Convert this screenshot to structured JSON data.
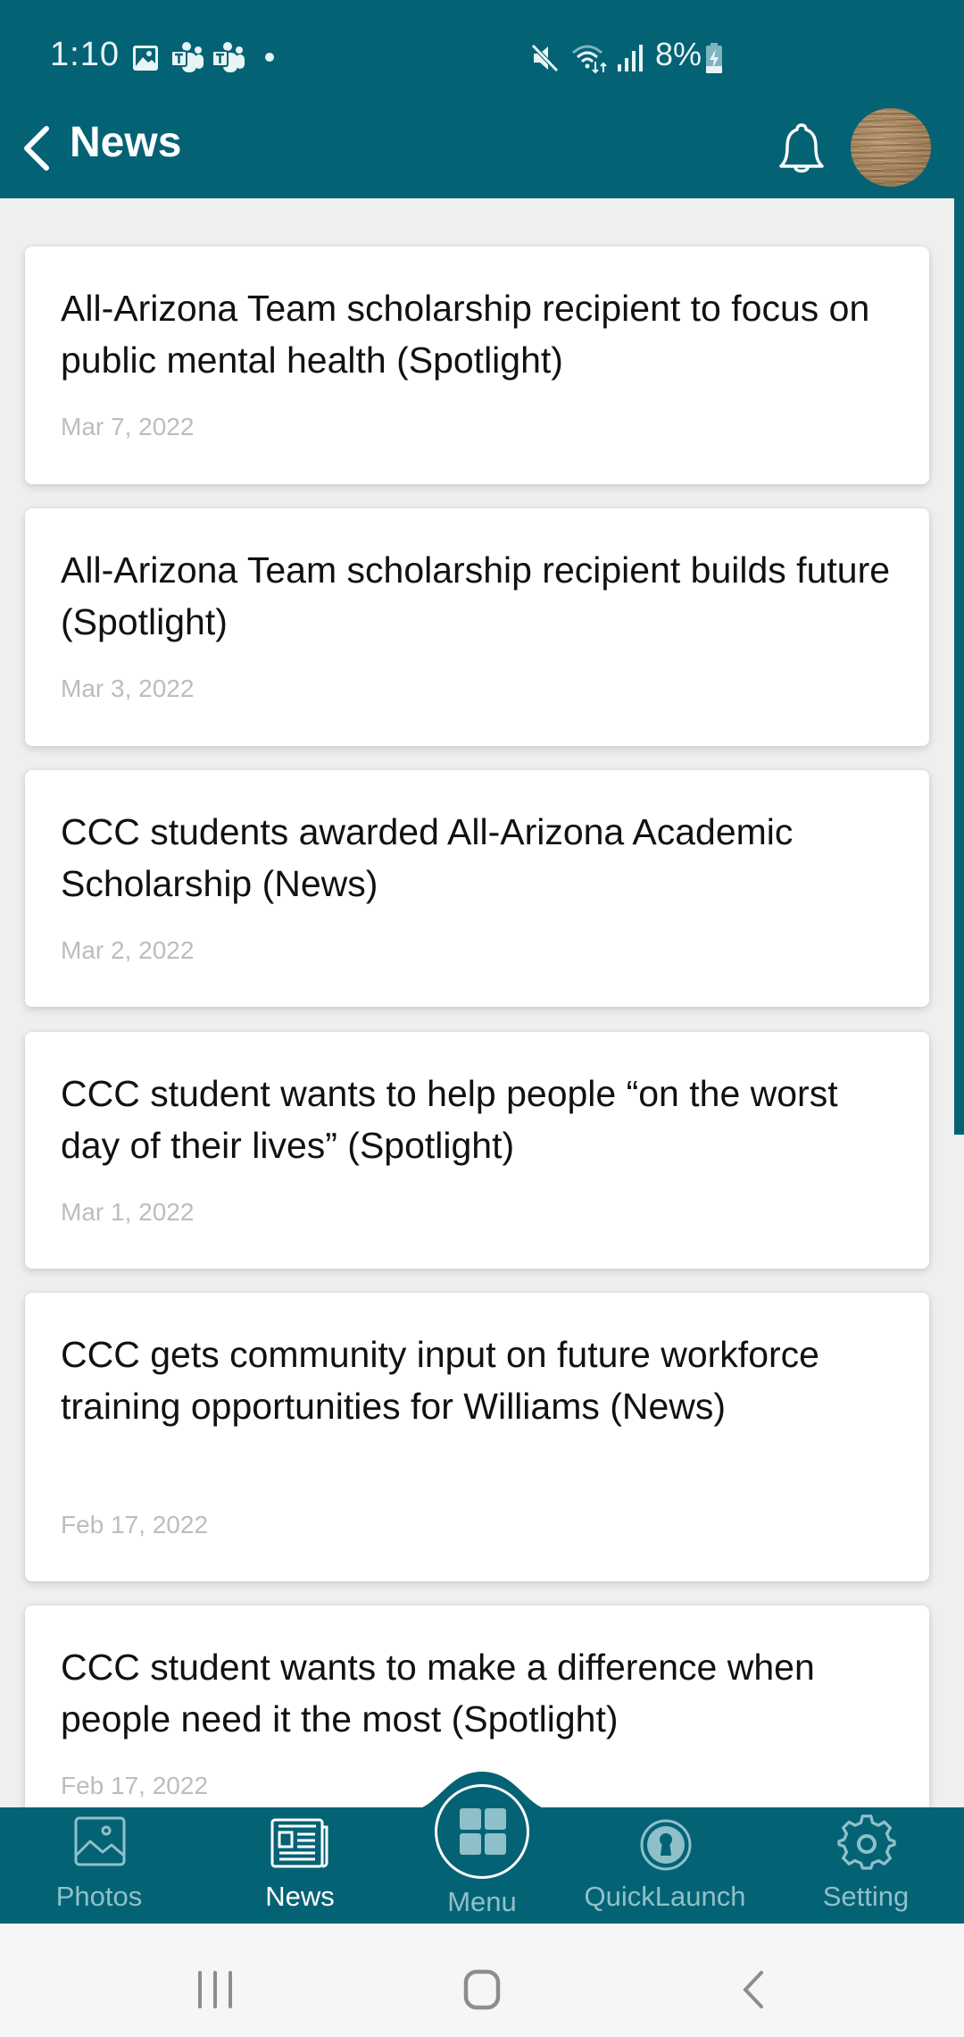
{
  "status_bar": {
    "time": "1:10",
    "left_icons": [
      "gallery-icon",
      "teams-icon",
      "teams-icon",
      "dot-icon"
    ],
    "right_icons": [
      "mute-icon",
      "wifi-icon",
      "signal-icon",
      "battery-charging-icon"
    ],
    "battery_percent": "8%"
  },
  "header": {
    "title": "News",
    "back_icon": "chevron-left-icon",
    "notification_icon": "bell-icon",
    "avatar": "user-avatar"
  },
  "news": [
    {
      "title": "All-Arizona Team scholarship recipient to focus on public mental health (Spotlight)",
      "date": "Mar 7, 2022"
    },
    {
      "title": "All-Arizona Team scholarship recipient builds future (Spotlight)",
      "date": "Mar 3, 2022"
    },
    {
      "title": "CCC students awarded All-Arizona Academic Scholarship (News)",
      "date": "Mar 2, 2022"
    },
    {
      "title": "CCC student wants to help people “on the worst day of their lives” (Spotlight)",
      "date": "Mar 1, 2022"
    },
    {
      "title": "CCC gets community input on future workforce training opportunities for Williams (News)",
      "date": "Feb 17, 2022"
    },
    {
      "title": "CCC student wants to make a difference when people need it the most (Spotlight)",
      "date": "Feb 17, 2022"
    }
  ],
  "bottom_nav": {
    "items": [
      {
        "label": "Photos",
        "icon": "photo-icon",
        "active": false
      },
      {
        "label": "News",
        "icon": "newspaper-icon",
        "active": true
      },
      {
        "label": "Menu",
        "icon": "grid-icon",
        "active": false
      },
      {
        "label": "QuickLaunch",
        "icon": "keyhole-icon",
        "active": false
      },
      {
        "label": "Setting",
        "icon": "gear-icon",
        "active": false
      }
    ]
  },
  "system_nav": {
    "recents": "recents-icon",
    "home": "home-icon",
    "back": "back-icon"
  },
  "colors": {
    "primary": "#046275",
    "nav_inactive": "#8fc0c9",
    "date_text": "#bdbdbd"
  }
}
